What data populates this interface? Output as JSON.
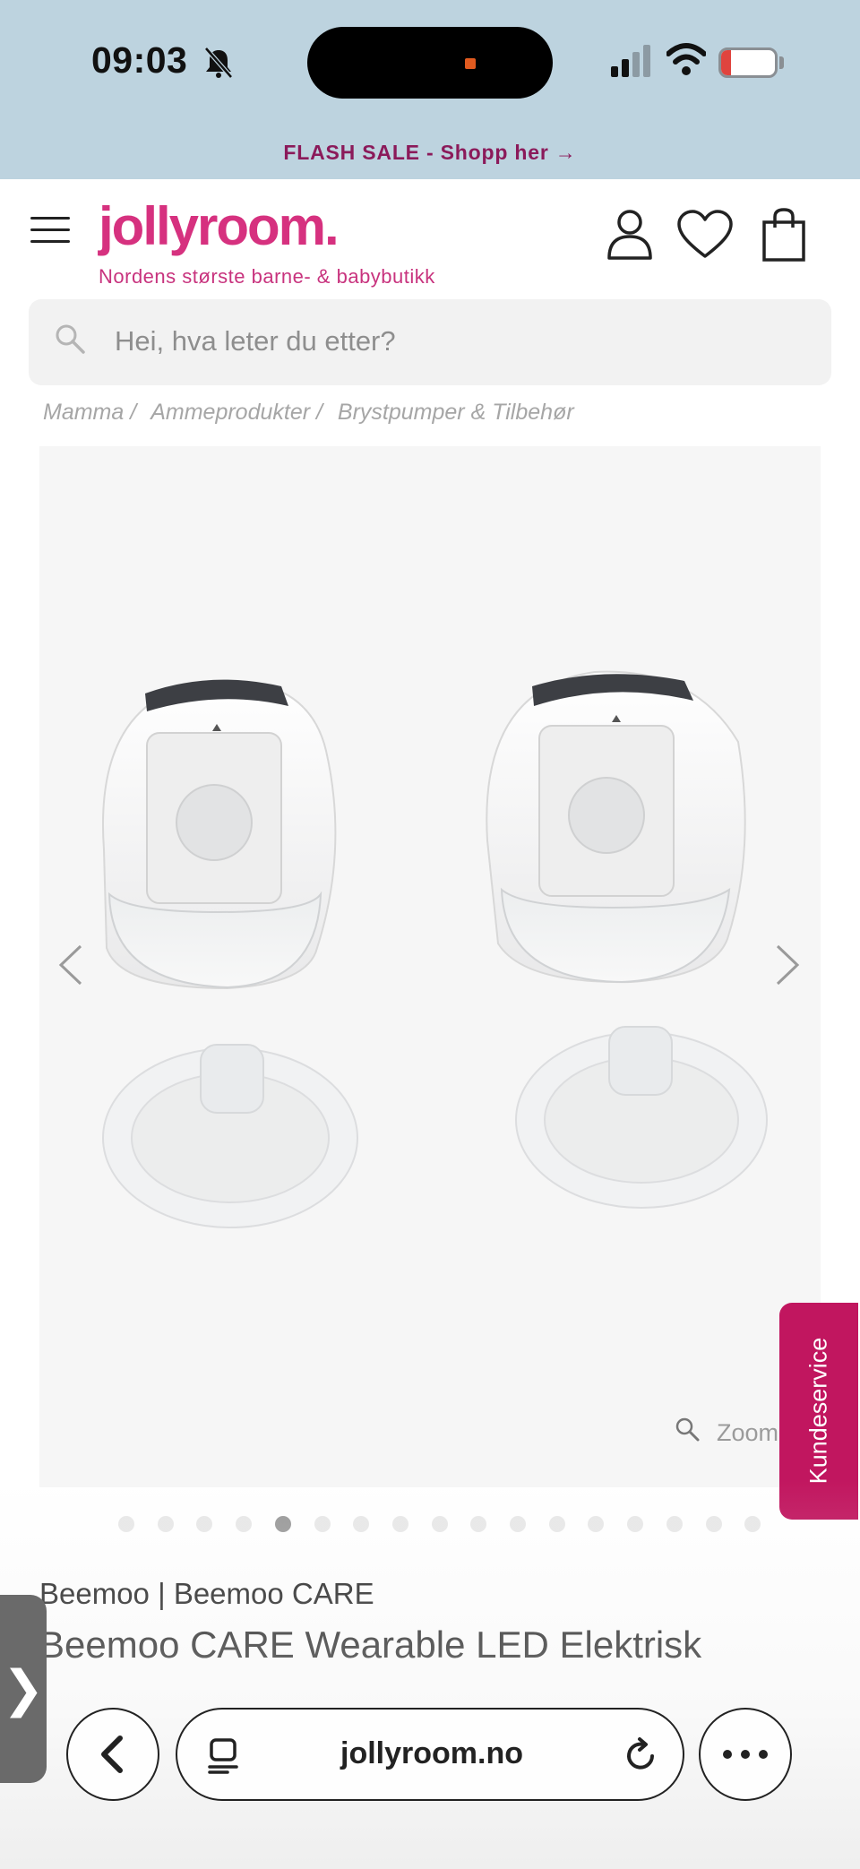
{
  "status_bar": {
    "time": "09:03",
    "battery": "18",
    "battery_level": 0.18
  },
  "promo": {
    "text": "FLASH SALE - Shopp her →"
  },
  "header": {
    "logo": "jollyroom.",
    "tagline": "Nordens største barne- & babybutikk",
    "icons": [
      "menu-icon",
      "account-icon",
      "heart-icon",
      "shopping-bag-icon"
    ]
  },
  "search": {
    "placeholder": "Hei, hva leter du etter?"
  },
  "breadcrumb": [
    "Mamma /",
    "Ammeprodukter /",
    "Brystpumper & Tilbehør"
  ],
  "gallery": {
    "zoom_label": "Zoom",
    "dot_count": 17,
    "active_index": 4
  },
  "support": {
    "label": "Kundeservice"
  },
  "product": {
    "brand": "Beemoo | Beemoo CARE",
    "title": "Beemoo CARE Wearable LED Elektrisk"
  },
  "browser": {
    "url": "jollyroom.no"
  },
  "colors": {
    "brand_pink": "#d6317f",
    "promo_text": "#8b1a5a",
    "status_bg": "#bdd3df",
    "support_bg": "#c1165f"
  }
}
